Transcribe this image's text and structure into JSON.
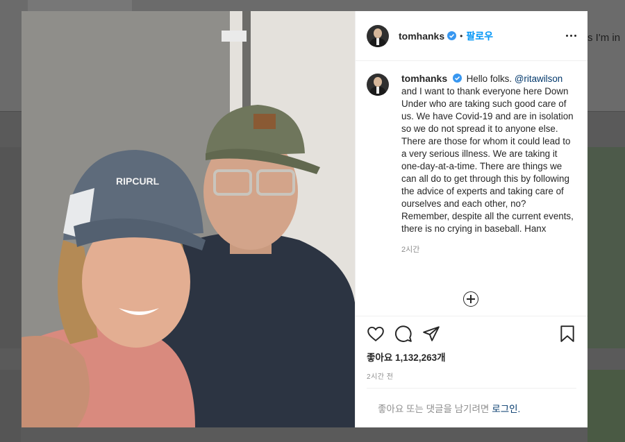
{
  "background": {
    "side_text": "s I'm in"
  },
  "post": {
    "username": "tomhanks",
    "dot": "•",
    "follow_label": "팔로우",
    "caption_username": "tomhanks",
    "caption_start": "Hello folks.",
    "mention": "@ritawilson",
    "caption_rest": "and I want to thank everyone here Down Under who are taking such good care of us. We have Covid-19 and are in isolation so we do not spread it to anyone else. There are those for whom it could lead to a very serious illness. We are taking it one-day-at-a-time. There are things we can all do to get through this by following the advice of experts and taking care of ourselves and each other, no? Remember, despite all the current events, there is no crying in baseball. Hanx",
    "caption_time": "2시간",
    "likes_label": "좋아요",
    "likes_count": "1,132,263개",
    "posted_time": "2시간 전",
    "login_prompt": "좋아요 또는 댓글을 남기려면",
    "login_link": "로그인.",
    "verified_color": "#3897f0",
    "icons": [
      "heart-icon",
      "comment-icon",
      "share-icon",
      "bookmark-icon",
      "more-icon",
      "add-circle-icon",
      "verified-badge-icon"
    ]
  }
}
